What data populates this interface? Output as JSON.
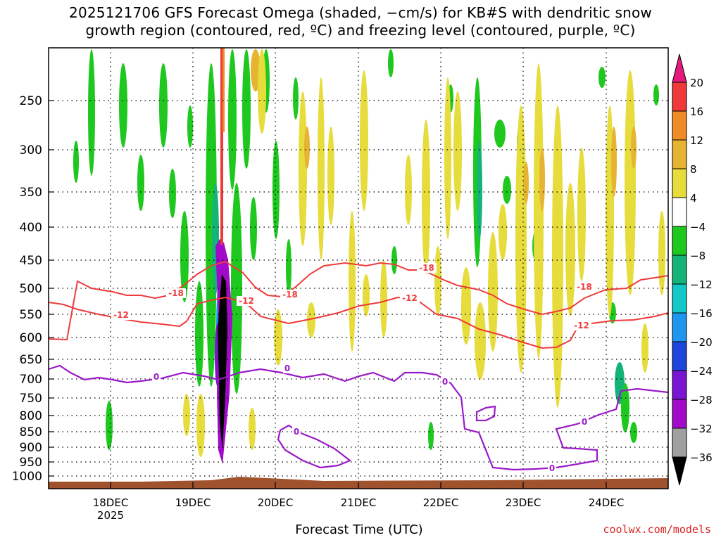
{
  "title_line1": "2025121706 GFS Forecast Omega (shaded, −cm/s) for KB#S with dendritic snow",
  "title_line2": "growth region (contoured, red, ºC) and freezing level (contoured, purple, ºC)",
  "xlabel": "Forecast Time (UTC)",
  "credit": "coolwx.com/models",
  "colors": {
    "dgz_contour": "#ee3b3b",
    "freezing_contour": "#9a1ac8",
    "terrain": "#a0522d",
    "grid": "#000000"
  },
  "chart_data": {
    "type": "heatmap",
    "y_axis": {
      "label": "",
      "scale": "pressure",
      "inverted": true,
      "ticks": [
        250,
        300,
        350,
        400,
        450,
        500,
        550,
        600,
        650,
        700,
        750,
        800,
        850,
        900,
        950,
        1000
      ]
    },
    "x_axis": {
      "label": "Forecast Time (UTC)",
      "ticks": [
        {
          "label": "18DEC",
          "sub": "2025"
        },
        {
          "label": "19DEC"
        },
        {
          "label": "20DEC"
        },
        {
          "label": "21DEC"
        },
        {
          "label": "22DEC"
        },
        {
          "label": "23DEC"
        },
        {
          "label": "24DEC"
        }
      ]
    },
    "colorbar": {
      "levels": [
        20,
        16,
        12,
        8,
        4,
        -4,
        -8,
        -12,
        -16,
        -20,
        -24,
        -28,
        -32,
        -36
      ],
      "colors": [
        "#e61a7d",
        "#f03a3a",
        "#f08c28",
        "#e6b432",
        "#e6dc3c",
        "#ffffff",
        "#1ec81e",
        "#14b478",
        "#14c8c8",
        "#1e96f0",
        "#1e46dc",
        "#7814d2",
        "#a00ac8",
        "#a0a0a0",
        "#000000"
      ]
    },
    "contour_labels": [
      {
        "value": "-18",
        "series": "dgz"
      },
      {
        "value": "-18",
        "series": "dgz"
      },
      {
        "value": "-18",
        "series": "dgz"
      },
      {
        "value": "-18",
        "series": "dgz"
      },
      {
        "value": "-12",
        "series": "dgz"
      },
      {
        "value": "-12",
        "series": "dgz"
      },
      {
        "value": "-12",
        "series": "dgz"
      },
      {
        "value": "-12",
        "series": "dgz"
      },
      {
        "value": "0",
        "series": "freezing"
      },
      {
        "value": "0",
        "series": "freezing"
      },
      {
        "value": "0",
        "series": "freezing"
      },
      {
        "value": "0",
        "series": "freezing"
      },
      {
        "value": "0",
        "series": "freezing"
      },
      {
        "value": "0",
        "series": "freezing"
      }
    ],
    "shaded_regions_approx": [
      {
        "time": "19DEC 09Z",
        "p_top": 450,
        "p_bottom": 950,
        "omega_max": -36
      },
      {
        "time": "19DEC 06Z",
        "p_top": 250,
        "p_bottom": 700,
        "omega_max": -16
      },
      {
        "time": "21DEC-24DEC",
        "p_top": 250,
        "p_bottom": 900,
        "omega_max": 12
      }
    ]
  }
}
